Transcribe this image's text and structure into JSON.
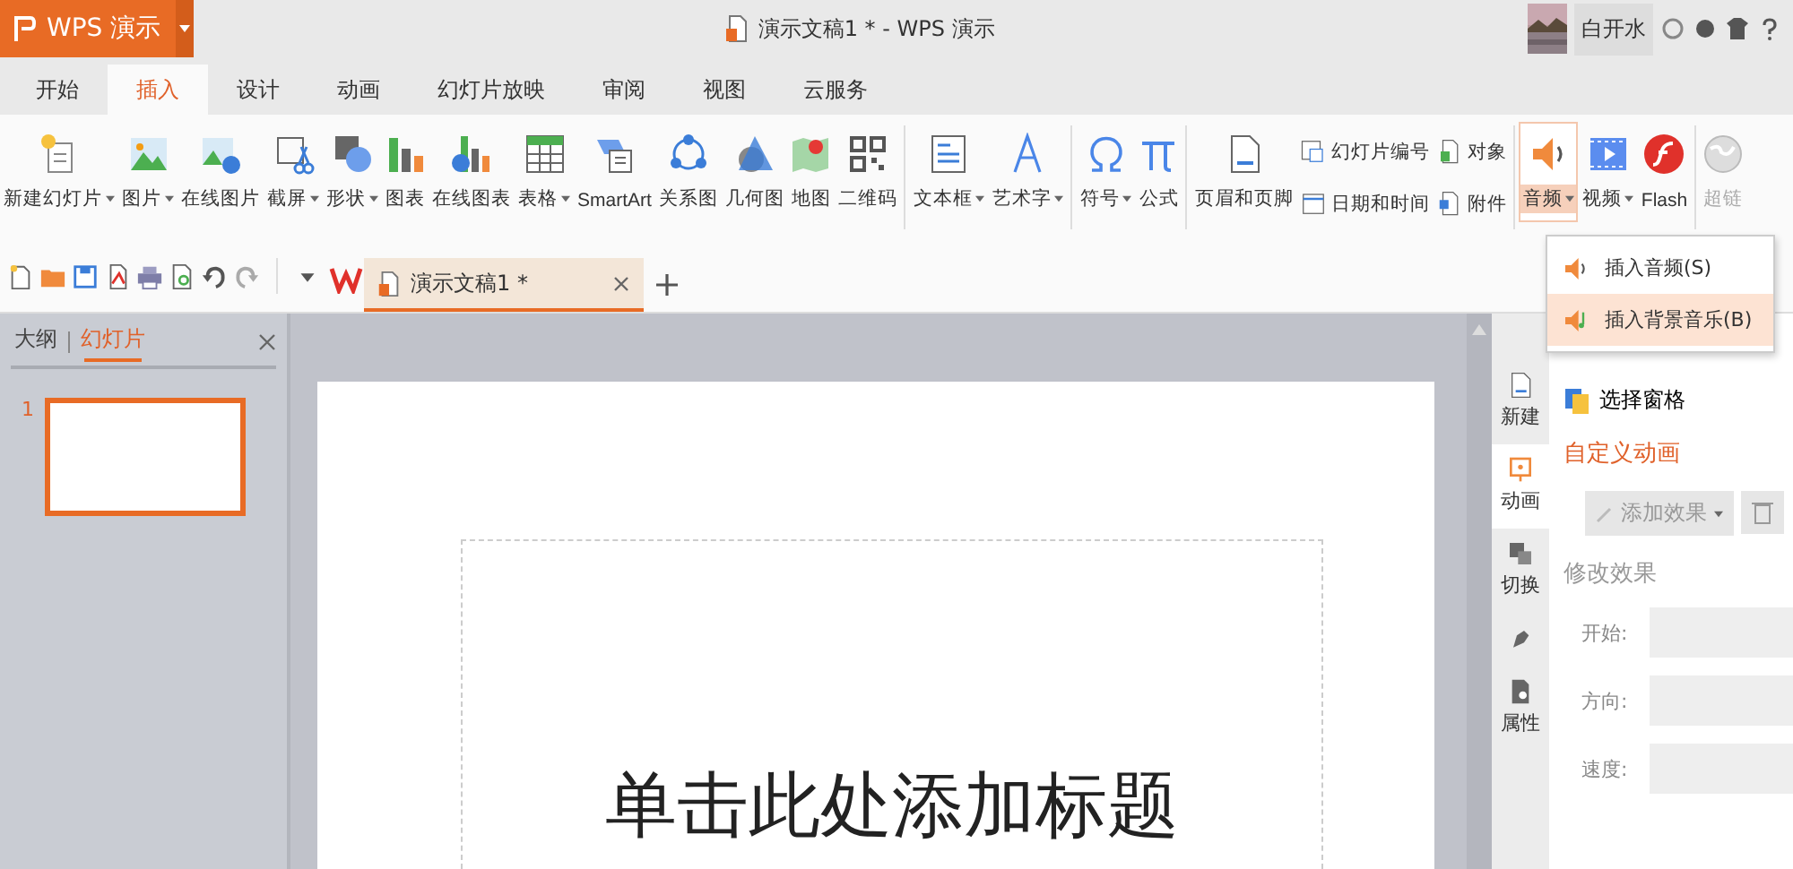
{
  "app_button": {
    "label": "WPS 演示"
  },
  "window": {
    "title": "演示文稿1 * - WPS 演示"
  },
  "user": {
    "name": "白开水"
  },
  "tabs": [
    {
      "label": "开始",
      "selected": false
    },
    {
      "label": "插入",
      "selected": true
    },
    {
      "label": "设计",
      "selected": false
    },
    {
      "label": "动画",
      "selected": false
    },
    {
      "label": "幻灯片放映",
      "selected": false
    },
    {
      "label": "审阅",
      "selected": false
    },
    {
      "label": "视图",
      "selected": false
    },
    {
      "label": "云服务",
      "selected": false
    }
  ],
  "ribbon": [
    {
      "kind": "big",
      "label": "新建幻灯片",
      "dropdown": true
    },
    {
      "kind": "big",
      "label": "图片",
      "dropdown": true
    },
    {
      "kind": "big",
      "label": "在线图片",
      "dropdown": false
    },
    {
      "kind": "big",
      "label": "截屏",
      "dropdown": true
    },
    {
      "kind": "big",
      "label": "形状",
      "dropdown": true
    },
    {
      "kind": "big",
      "label": "图表",
      "dropdown": false
    },
    {
      "kind": "big",
      "label": "在线图表",
      "dropdown": false
    },
    {
      "kind": "big",
      "label": "表格",
      "dropdown": true
    },
    {
      "kind": "big",
      "label": "SmartArt",
      "dropdown": false
    },
    {
      "kind": "big",
      "label": "关系图",
      "dropdown": false
    },
    {
      "kind": "big",
      "label": "几何图",
      "dropdown": false
    },
    {
      "kind": "big",
      "label": "地图",
      "dropdown": false
    },
    {
      "kind": "big",
      "label": "二维码",
      "dropdown": false
    },
    {
      "kind": "separator"
    },
    {
      "kind": "big",
      "label": "文本框",
      "dropdown": true
    },
    {
      "kind": "big",
      "label": "艺术字",
      "dropdown": true
    },
    {
      "kind": "separator"
    },
    {
      "kind": "big",
      "label": "符号",
      "dropdown": true
    },
    {
      "kind": "big",
      "label": "公式",
      "dropdown": false
    },
    {
      "kind": "separator"
    },
    {
      "kind": "big",
      "label": "页眉和页脚",
      "dropdown": false
    },
    {
      "kind": "small",
      "items": [
        {
          "label": "幻灯片编号"
        },
        {
          "label": "日期和时间"
        }
      ]
    },
    {
      "kind": "small",
      "items": [
        {
          "label": "对象"
        },
        {
          "label": "附件"
        }
      ]
    },
    {
      "kind": "separator"
    },
    {
      "kind": "big",
      "label": "音频",
      "dropdown": true,
      "selected": true
    },
    {
      "kind": "big",
      "label": "视频",
      "dropdown": true,
      "selected": false
    },
    {
      "kind": "big",
      "label": "Flash",
      "dropdown": false,
      "selected": false
    },
    {
      "kind": "separator"
    },
    {
      "kind": "big",
      "label": "超链",
      "dropdown": false,
      "disabled": true
    }
  ],
  "audio_menu": [
    {
      "label": "插入音频(S)",
      "selected": false
    },
    {
      "label": "插入背景音乐(B)",
      "selected": true
    }
  ],
  "document_tab": {
    "label": "演示文稿1 *"
  },
  "left_panel": {
    "tabs": [
      {
        "label": "大纲",
        "selected": false
      },
      {
        "label": "幻灯片",
        "selected": true
      }
    ],
    "slides": [
      {
        "number": "1",
        "selected": true
      }
    ]
  },
  "slide": {
    "title_placeholder": "单击此处添加标题"
  },
  "side_tabs": [
    {
      "label": "新建",
      "selected": false
    },
    {
      "label": "动画",
      "selected": true
    },
    {
      "label": "切换",
      "selected": false
    },
    {
      "selected": false
    },
    {
      "label": "属性",
      "selected": false
    }
  ],
  "animation_panel": {
    "select_pane": "选择窗格",
    "heading": "自定义动画",
    "add_effect": "添加效果",
    "modify_heading": "修改效果",
    "fields": [
      {
        "label": "开始:"
      },
      {
        "label": "方向:"
      },
      {
        "label": "速度:"
      }
    ]
  }
}
